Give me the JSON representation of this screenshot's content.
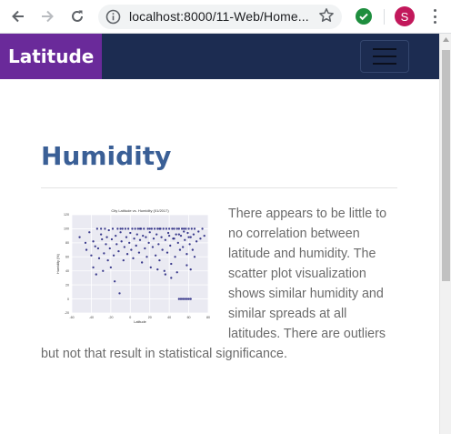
{
  "browser": {
    "url": "localhost:8000/11-Web/Home...",
    "profile_initial": "S",
    "icons": [
      "back-arrow-icon",
      "forward-arrow-icon",
      "reload-icon",
      "info-icon",
      "star-icon",
      "extension-check-icon",
      "more-vert-icon"
    ],
    "colors": {
      "extension": "#1e8e3e",
      "avatar": "#c2185b"
    }
  },
  "navbar": {
    "brand": "Latitude",
    "colors": {
      "bar": "#1c2c51",
      "brand_bg": "#6a2a9a"
    }
  },
  "main": {
    "heading": "Humidity",
    "description": "There appears to be little to no correlation between latitude and humidity. The scatter plot visualization shows similar humidity and similar spreads at all latitudes. There are outliers but not that result in statistical significance.",
    "colors": {
      "heading": "#3a5f96",
      "text": "#6b6b6b"
    }
  },
  "chart_data": {
    "type": "scatter",
    "title": "City Latitude vs. Humidity (01/2017)",
    "xlabel": "Latitude",
    "ylabel": "Humidity (%)",
    "xlim": [
      -60,
      80
    ],
    "ylim": [
      -20,
      120
    ],
    "xticks": [
      -60,
      -40,
      -20,
      0,
      20,
      40,
      60,
      80
    ],
    "yticks": [
      -20,
      0,
      20,
      40,
      60,
      80,
      100,
      120
    ],
    "grid": true,
    "marker_color": "#1b1b7a",
    "background": "#eaeaf2",
    "points": [
      [
        -52,
        88
      ],
      [
        -46,
        80
      ],
      [
        -45,
        70
      ],
      [
        -42,
        95
      ],
      [
        -40,
        62
      ],
      [
        -38,
        45
      ],
      [
        -38,
        82
      ],
      [
        -36,
        75
      ],
      [
        -35,
        35
      ],
      [
        -34,
        100
      ],
      [
        -33,
        72
      ],
      [
        -32,
        58
      ],
      [
        -30,
        92
      ],
      [
        -29,
        85
      ],
      [
        -28,
        40
      ],
      [
        -27,
        65
      ],
      [
        -26,
        100
      ],
      [
        -25,
        78
      ],
      [
        -24,
        88
      ],
      [
        -23,
        55
      ],
      [
        -22,
        98
      ],
      [
        -21,
        72
      ],
      [
        -20,
        45
      ],
      [
        -19,
        85
      ],
      [
        -18,
        100
      ],
      [
        -17,
        62
      ],
      [
        -16,
        25
      ],
      [
        -15,
        90
      ],
      [
        -14,
        78
      ],
      [
        -13,
        100
      ],
      [
        -12,
        68
      ],
      [
        -11,
        8
      ],
      [
        -10,
        95
      ],
      [
        -9,
        82
      ],
      [
        -8,
        100
      ],
      [
        -7,
        55
      ],
      [
        -6,
        74
      ],
      [
        -5,
        100
      ],
      [
        -4,
        88
      ],
      [
        -3,
        64
      ],
      [
        -2,
        100
      ],
      [
        -1,
        80
      ],
      [
        0,
        94
      ],
      [
        1,
        70
      ],
      [
        2,
        100
      ],
      [
        3,
        58
      ],
      [
        4,
        86
      ],
      [
        5,
        100
      ],
      [
        6,
        76
      ],
      [
        7,
        92
      ],
      [
        8,
        100
      ],
      [
        9,
        66
      ],
      [
        10,
        84
      ],
      [
        11,
        100
      ],
      [
        12,
        52
      ],
      [
        13,
        90
      ],
      [
        14,
        100
      ],
      [
        15,
        72
      ],
      [
        16,
        88
      ],
      [
        17,
        60
      ],
      [
        18,
        100
      ],
      [
        19,
        80
      ],
      [
        20,
        95
      ],
      [
        21,
        45
      ],
      [
        22,
        100
      ],
      [
        23,
        74
      ],
      [
        24,
        86
      ],
      [
        25,
        100
      ],
      [
        26,
        62
      ],
      [
        27,
        92
      ],
      [
        28,
        100
      ],
      [
        29,
        78
      ],
      [
        30,
        55
      ],
      [
        31,
        100
      ],
      [
        32,
        88
      ],
      [
        33,
        70
      ],
      [
        34,
        100
      ],
      [
        35,
        40
      ],
      [
        36,
        84
      ],
      [
        37,
        100
      ],
      [
        38,
        66
      ],
      [
        39,
        94
      ],
      [
        40,
        100
      ],
      [
        41,
        76
      ],
      [
        42,
        50
      ],
      [
        43,
        100
      ],
      [
        44,
        86
      ],
      [
        45,
        100
      ],
      [
        46,
        60
      ],
      [
        47,
        92
      ],
      [
        48,
        100
      ],
      [
        49,
        80
      ],
      [
        50,
        100
      ],
      [
        51,
        70
      ],
      [
        52,
        90
      ],
      [
        53,
        100
      ],
      [
        54,
        74
      ],
      [
        55,
        100
      ],
      [
        56,
        84
      ],
      [
        57,
        100
      ],
      [
        58,
        64
      ],
      [
        59,
        94
      ],
      [
        60,
        100
      ],
      [
        61,
        78
      ],
      [
        62,
        88
      ],
      [
        63,
        100
      ],
      [
        64,
        70
      ],
      [
        65,
        92
      ],
      [
        66,
        100
      ],
      [
        68,
        82
      ],
      [
        70,
        96
      ],
      [
        72,
        86
      ],
      [
        74,
        100
      ],
      [
        76,
        90
      ],
      [
        -30,
        100
      ],
      [
        -10,
        100
      ],
      [
        10,
        100
      ],
      [
        20,
        100
      ],
      [
        30,
        100
      ],
      [
        40,
        90
      ],
      [
        45,
        86
      ],
      [
        50,
        92
      ],
      [
        55,
        96
      ],
      [
        60,
        88
      ],
      [
        42,
        30
      ],
      [
        48,
        38
      ],
      [
        58,
        48
      ],
      [
        62,
        42
      ],
      [
        66,
        60
      ],
      [
        36,
        35
      ],
      [
        28,
        42
      ],
      [
        50,
        0
      ],
      [
        52,
        0
      ],
      [
        54,
        0
      ],
      [
        56,
        0
      ],
      [
        58,
        0
      ],
      [
        60,
        0
      ],
      [
        62,
        0
      ]
    ]
  }
}
